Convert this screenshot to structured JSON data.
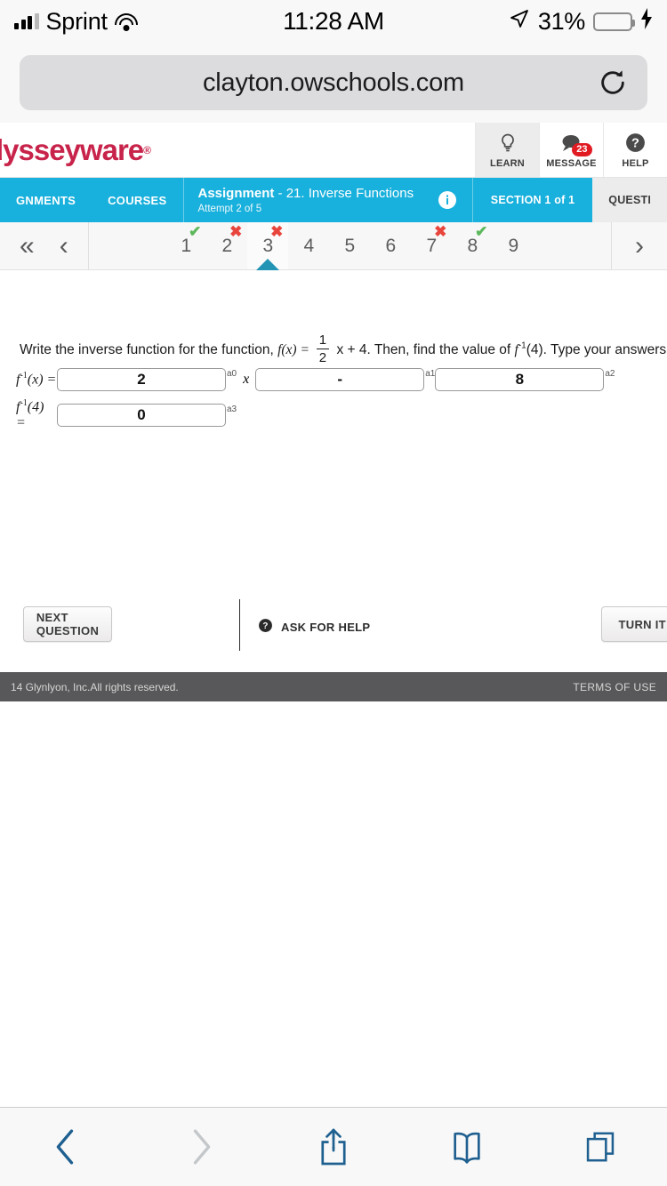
{
  "status_bar": {
    "carrier": "Sprint",
    "time": "11:28 AM",
    "battery_percent": "31%",
    "signal_icon": "signal-bars-icon",
    "wifi_icon": "wifi-icon",
    "location_icon": "location-arrow-icon",
    "battery_icon": "battery-icon",
    "charging_icon": "lightning-bolt-icon"
  },
  "browser": {
    "url": "clayton.owschools.com",
    "reload_icon": "reload-icon",
    "bottom_toolbar": [
      {
        "name": "back-button",
        "icon": "chevron-left-icon",
        "enabled": true
      },
      {
        "name": "forward-button",
        "icon": "chevron-right-icon",
        "enabled": false
      },
      {
        "name": "share-button",
        "icon": "share-icon",
        "enabled": true
      },
      {
        "name": "bookmarks-button",
        "icon": "book-icon",
        "enabled": true
      },
      {
        "name": "tabs-button",
        "icon": "tabs-icon",
        "enabled": true
      }
    ]
  },
  "site_header": {
    "logo_text": "dysseyware",
    "logo_registered": "®",
    "logo_color": "#c8244b",
    "tools": [
      {
        "label": "LEARN",
        "icon": "lightbulb-icon",
        "active": true,
        "badge": ""
      },
      {
        "label": "MESSAGE",
        "icon": "speech-bubble-icon",
        "active": false,
        "badge": "23"
      },
      {
        "label": "HELP",
        "icon": "question-circle-icon",
        "active": false,
        "badge": ""
      }
    ]
  },
  "assignment_bar": {
    "accent_color": "#18b0dc",
    "nav_assignments": "GNMENTS",
    "nav_courses": "COURSES",
    "title_label": "Assignment",
    "title_value": "- 21. Inverse Functions",
    "attempt": "Attempt 2 of 5",
    "info_icon": "info-circle-icon",
    "section": "SECTION 1 of 1",
    "question_tab": "QUESTI"
  },
  "question_nav": {
    "first_icon": "double-chevron-left-icon",
    "prev_icon": "chevron-left-icon",
    "next_icon": "chevron-right-icon",
    "items": [
      {
        "number": "1",
        "mark": "correct"
      },
      {
        "number": "2",
        "mark": "incorrect"
      },
      {
        "number": "3",
        "mark": "incorrect",
        "current": true
      },
      {
        "number": "4",
        "mark": "none"
      },
      {
        "number": "5",
        "mark": "none"
      },
      {
        "number": "6",
        "mark": "none"
      },
      {
        "number": "7",
        "mark": "incorrect"
      },
      {
        "number": "8",
        "mark": "correct"
      },
      {
        "number": "9",
        "mark": "none"
      }
    ],
    "correct_color": "#5cb85c",
    "incorrect_color": "#e8453c",
    "current_pointer_color": "#2494b5"
  },
  "question": {
    "prompt_part1": "Write the inverse function for the function, ",
    "fn_label": "f",
    "fn_arg": "(x) = ",
    "fraction_numerator": "1",
    "fraction_denominator": "2",
    "prompt_part2": " x + 4. Then, find the value of ",
    "inverse_label": "f",
    "inverse_exp": "-1",
    "inverse_arg": "(4). ",
    "prompt_part3": "Type your answers in the box.",
    "answers": [
      {
        "row_label_fn": "f",
        "row_label_exp": "-1",
        "row_label_arg": "(x) =",
        "fields": [
          {
            "tag": "a0",
            "value": "2"
          },
          {
            "separator": "x"
          },
          {
            "tag": "a1",
            "value": "-"
          },
          {
            "tag": "a2",
            "value": "8"
          }
        ]
      },
      {
        "row_label_fn": "f",
        "row_label_exp": "-1",
        "row_label_arg": "(4) =",
        "fields": [
          {
            "tag": "a3",
            "value": "0"
          }
        ]
      }
    ]
  },
  "actions": {
    "next_question": "NEXT QUESTION",
    "ask_for_help": "ASK FOR HELP",
    "ask_help_icon": "question-circle-icon",
    "turn_it_in": "TURN IT IN"
  },
  "footer": {
    "copyright": "14 Glynlyon, Inc.All rights reserved.",
    "terms": "TERMS OF USE"
  }
}
